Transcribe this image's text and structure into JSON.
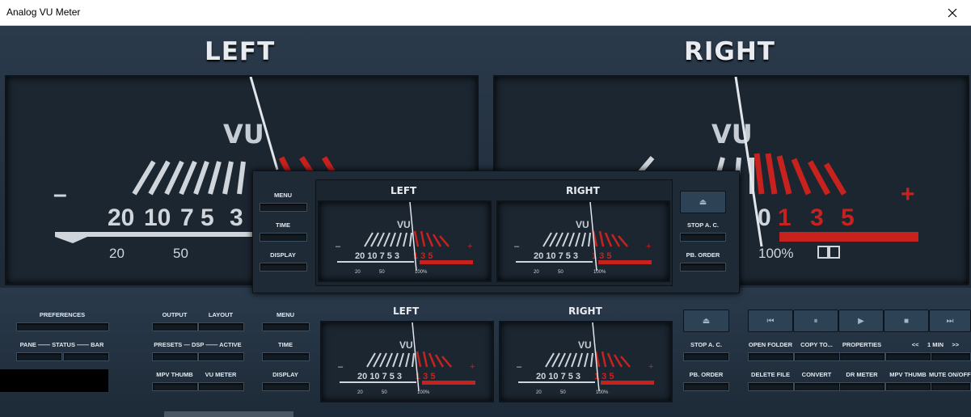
{
  "window": {
    "title": "Analog VU Meter"
  },
  "main_meters": {
    "left_label": "LEFT",
    "right_label": "RIGHT",
    "vu_text": "VU",
    "scale_white": [
      "20",
      "10",
      "7",
      "5",
      "3"
    ],
    "scale_red": [
      "0",
      "1",
      "3",
      "5"
    ],
    "minus": "–",
    "plus": "+",
    "percent_scale": [
      "20",
      "50",
      "100%"
    ]
  },
  "overlay": {
    "left_label": "LEFT",
    "right_label": "RIGHT",
    "buttons_left": [
      "MENU",
      "TIME",
      "DISPLAY"
    ],
    "buttons_right": [
      "STOP A. C.",
      "PB. ORDER"
    ]
  },
  "panel": {
    "left_label": "LEFT",
    "right_label": "RIGHT",
    "preferences": "PREFERENCES",
    "pane_row": {
      "pane": "PANE",
      "status": "STATUS",
      "bar": "BAR"
    },
    "output": "OUTPUT",
    "layout": "LAYOUT",
    "presets_row": {
      "presets": "PRESETS",
      "dsp": "DSP",
      "active": "ACTIVE"
    },
    "mpv_thumb": "MPV THUMB",
    "vu_meter": "VU METER",
    "menu": "MENU",
    "time": "TIME",
    "display": "DISPLAY",
    "stop_ac": "STOP A. C.",
    "pb_order": "PB. ORDER",
    "open_folder": "OPEN FOLDER",
    "copy_to": "COPY TO...",
    "properties": "PROPERTIES",
    "seek_back": "<<",
    "seek_amount": "1 MIN",
    "seek_fwd": ">>",
    "delete_file": "DELETE FILE",
    "convert": "CONVERT",
    "dr_meter": "DR METER",
    "mpv_thumb2": "MPV THUMB",
    "mute": "MUTE ON/OFF"
  },
  "colors": {
    "red": "#c8221e",
    "white": "#dde2e7",
    "bg": "#1b2531"
  }
}
